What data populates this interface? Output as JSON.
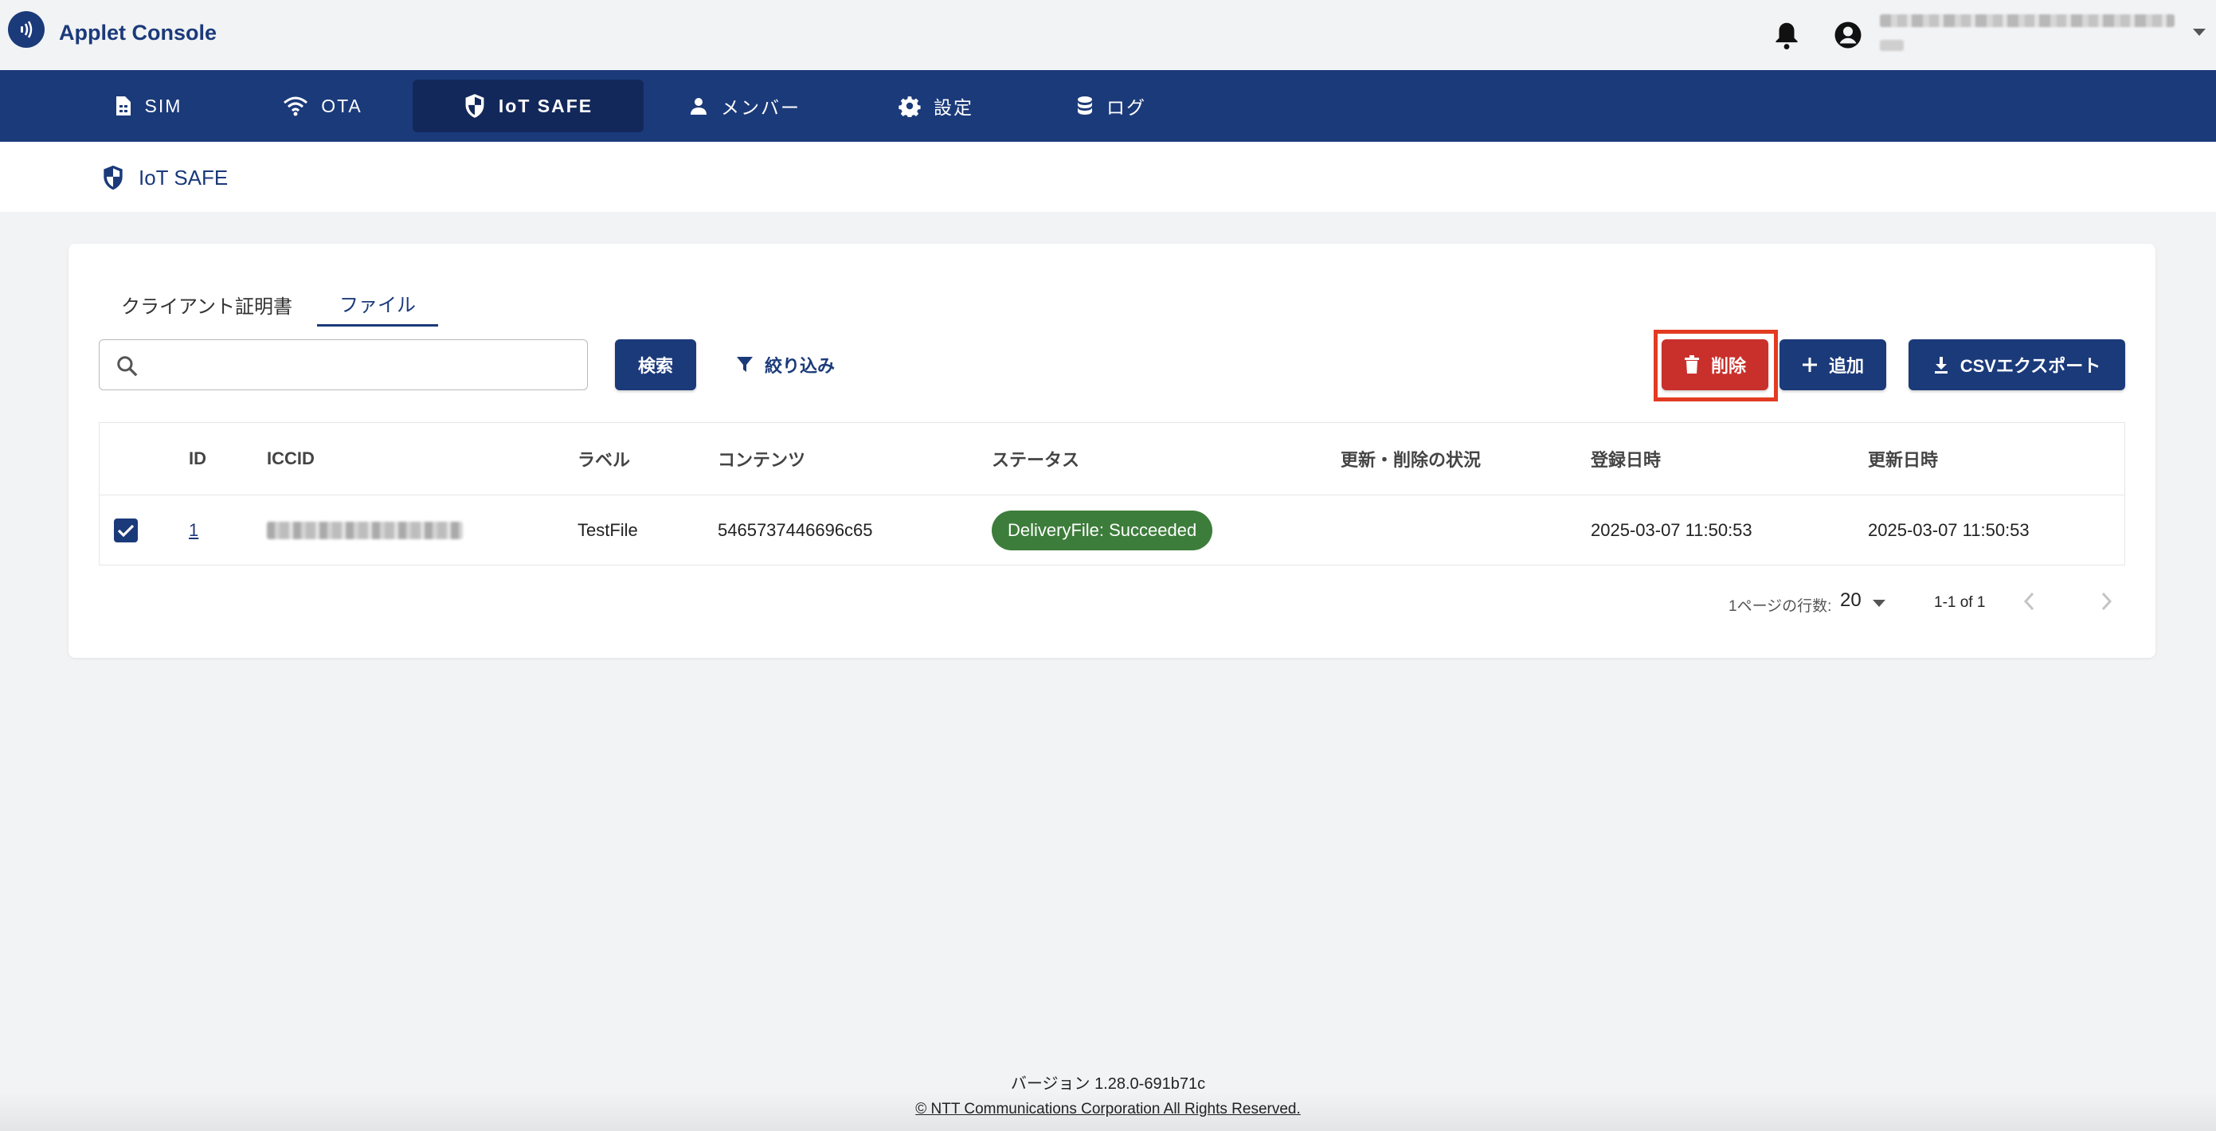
{
  "app": {
    "title": "Applet Console",
    "user_email": "",
    "icons": {
      "logo": "nfc-logo-icon",
      "notification": "bell-icon",
      "account": "account-circle-icon",
      "menu": "caret-down-icon"
    }
  },
  "nav": {
    "items": [
      {
        "label": "SIM",
        "icon": "sim-card-icon",
        "active": false
      },
      {
        "label": "OTA",
        "icon": "wifi-icon",
        "active": false
      },
      {
        "label": "IoT SAFE",
        "icon": "shield-icon",
        "active": true
      },
      {
        "label": "メンバー",
        "icon": "person-icon",
        "active": false
      },
      {
        "label": "設定",
        "icon": "gear-icon",
        "active": false
      },
      {
        "label": "ログ",
        "icon": "database-icon",
        "active": false
      }
    ],
    "colors": {
      "bar": "#1b3a7a",
      "active": "#13285a"
    }
  },
  "page": {
    "title": "IoT SAFE",
    "icon": "shield-icon"
  },
  "tabs": [
    {
      "label": "クライアント証明書",
      "active": false
    },
    {
      "label": "ファイル",
      "active": true
    }
  ],
  "toolbar": {
    "search_placeholder": "",
    "search_value": "",
    "search_label": "検索",
    "filter_label": "絞り込み",
    "delete_label": "削除",
    "add_label": "追加",
    "csv_label": "CSVエクスポート",
    "colors": {
      "primary": "#1b3a7a",
      "danger": "#c9302c",
      "highlight": "#e23b22"
    }
  },
  "table": {
    "headers": {
      "id": "ID",
      "iccid": "ICCID",
      "label": "ラベル",
      "content": "コンテンツ",
      "status": "ステータス",
      "state": "更新・削除の状況",
      "created": "登録日時",
      "updated": "更新日時"
    },
    "rows": [
      {
        "checked": true,
        "id": "1",
        "iccid": "",
        "label": "TestFile",
        "content": "5465737446696c65",
        "status": "DeliveryFile: Succeeded",
        "status_color": "#3d7d3b",
        "state": "",
        "created": "2025-03-07 11:50:53",
        "updated": "2025-03-07 11:50:53"
      }
    ]
  },
  "pagination": {
    "rows_per_page_label": "1ページの行数:",
    "rows_per_page": "20",
    "range": "1-1 of 1"
  },
  "footer": {
    "version": "バージョン 1.28.0-691b71c",
    "copyright": "© NTT Communications Corporation All Rights Reserved."
  }
}
